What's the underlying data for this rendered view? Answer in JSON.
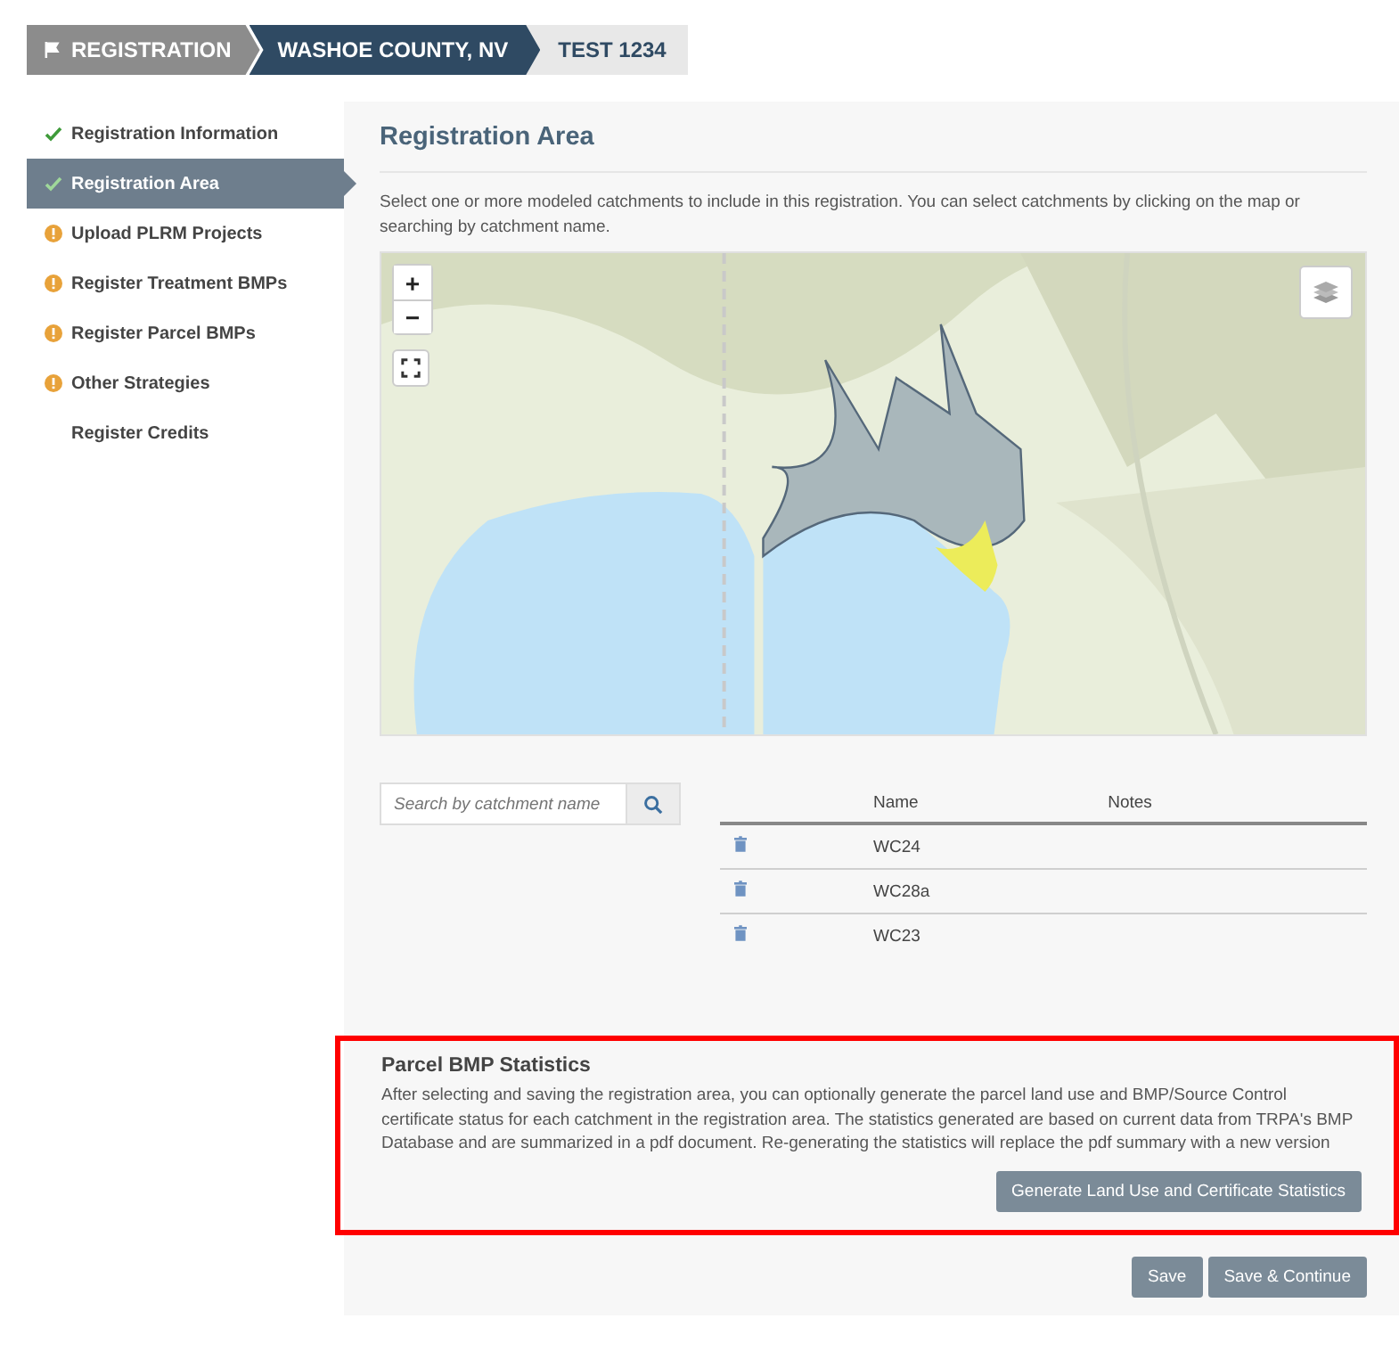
{
  "breadcrumbs": [
    {
      "label": "REGISTRATION",
      "kind": "root"
    },
    {
      "label": "WASHOE COUNTY, NV",
      "kind": "active"
    },
    {
      "label": "TEST 1234",
      "kind": "plain"
    }
  ],
  "sidebar": {
    "items": [
      {
        "label": "Registration Information",
        "kind": "done",
        "selected": false
      },
      {
        "label": "Registration Area",
        "kind": "done",
        "selected": true
      },
      {
        "label": "Upload PLRM Projects",
        "kind": "pending",
        "selected": false
      },
      {
        "label": "Register Treatment BMPs",
        "kind": "pending",
        "selected": false
      },
      {
        "label": "Register Parcel BMPs",
        "kind": "pending",
        "selected": false
      },
      {
        "label": "Other Strategies",
        "kind": "pending",
        "selected": false
      },
      {
        "label": "Register Credits",
        "kind": "none",
        "selected": false
      }
    ]
  },
  "main": {
    "title": "Registration Area",
    "intro": "Select one or more modeled catchments to include in this registration. You can select catchments by clicking on the map or searching by catchment name.",
    "map": {
      "kind": "picture",
      "zoom_in": "+",
      "zoom_out": "−"
    },
    "search": {
      "placeholder": "Search by catchment name"
    },
    "table": {
      "columns": [
        "Name",
        "Notes"
      ],
      "rows": [
        {
          "name": "WC24"
        },
        {
          "name": "WC28a"
        },
        {
          "name": "WC23"
        }
      ]
    },
    "stats": {
      "title": "Parcel BMP Statistics",
      "highlighted": true,
      "text": "After selecting and saving the registration area, you can optionally generate the parcel land use and BMP/Source Control certificate status for each catchment in the registration area. The statistics generated are based on current data from TRPA's BMP Database and are summarized in a pdf document. Re-generating the statistics will replace the pdf summary with a new version",
      "button": "Generate Land Use and Certificate Statistics"
    },
    "buttons": [
      "Save",
      "Save & Continue"
    ]
  }
}
